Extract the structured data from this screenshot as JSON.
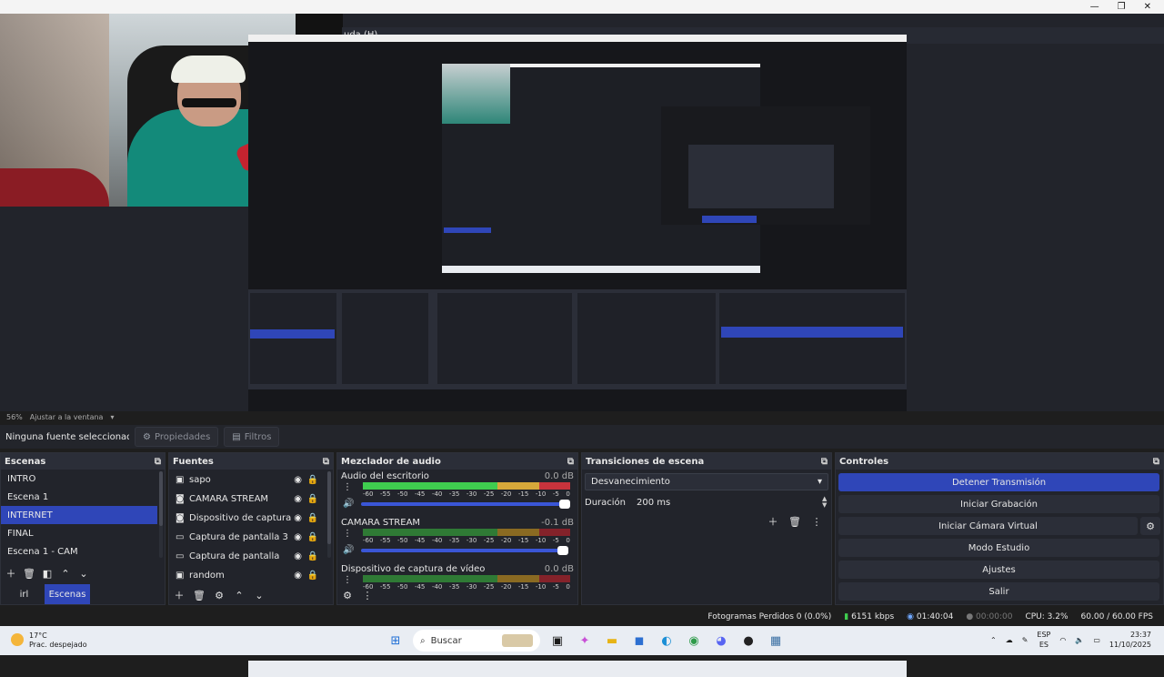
{
  "window": {
    "title": "",
    "menu_partial": "uda (H)",
    "controls": [
      "—",
      "❐",
      "✕"
    ]
  },
  "preview": {
    "zoom": "56%",
    "fit_label": "Ajustar a la ventana"
  },
  "toolbar": {
    "no_source": "Ninguna fuente seleccionada",
    "properties": "Propiedades",
    "filters": "Filtros"
  },
  "scenes": {
    "title": "Escenas",
    "items": [
      "INTRO",
      "Escena 1",
      "INTERNET",
      "FINAL",
      "Escena 1 - CAM"
    ],
    "selected": "INTERNET",
    "tabs": [
      "irl",
      "Escenas"
    ],
    "active_tab": "Escenas"
  },
  "sources": {
    "title": "Fuentes",
    "items": [
      {
        "name": "sapo",
        "icon": "image-icon"
      },
      {
        "name": "CAMARA STREAM",
        "icon": "camera-icon"
      },
      {
        "name": "Dispositivo de captura de vid",
        "icon": "camera-icon"
      },
      {
        "name": "Captura de pantalla 3",
        "icon": "monitor-icon"
      },
      {
        "name": "Captura de pantalla",
        "icon": "monitor-icon"
      },
      {
        "name": "random",
        "icon": "image-icon"
      }
    ]
  },
  "mixer": {
    "title": "Mezclador de audio",
    "ticks": [
      "-60",
      "-55",
      "-50",
      "-45",
      "-40",
      "-35",
      "-30",
      "-25",
      "-20",
      "-15",
      "-10",
      "-5",
      "0"
    ],
    "channels": [
      {
        "name": "Audio del escritorio",
        "db": "0.0 dB",
        "level": 1.0
      },
      {
        "name": "CAMARA STREAM",
        "db": "-0.1 dB",
        "level": 0.99
      },
      {
        "name": "Dispositivo de captura de vídeo",
        "db": "0.0 dB",
        "level": 1.0
      }
    ]
  },
  "transitions": {
    "title": "Transiciones de escena",
    "selected": "Desvanecimiento",
    "duration_label": "Duración",
    "duration_value": "200 ms"
  },
  "controls": {
    "title": "Controles",
    "buttons": [
      "Detener Transmisión",
      "Iniciar Grabación",
      "Iniciar Cámara Virtual",
      "Modo Estudio",
      "Ajustes",
      "Salir"
    ]
  },
  "status": {
    "dropped": "Fotogramas Perdidos 0 (0.0%)",
    "bitrate": "6151 kbps",
    "stream_time": "01:40:04",
    "rec_time": "00:00:00",
    "cpu": "CPU: 3.2%",
    "fps": "60.00 / 60.00 FPS"
  },
  "taskbar": {
    "temp": "17°C",
    "weather": "Prac. despejado",
    "search": "Buscar",
    "lang_top": "ESP",
    "lang_bottom": "ES",
    "time": "23:37",
    "date": "11/10/2025"
  },
  "colors": {
    "accent": "#2f46b8",
    "meter_green": "#3fcd4f",
    "meter_yellow": "#d6a83a",
    "meter_red": "#c8333c"
  }
}
